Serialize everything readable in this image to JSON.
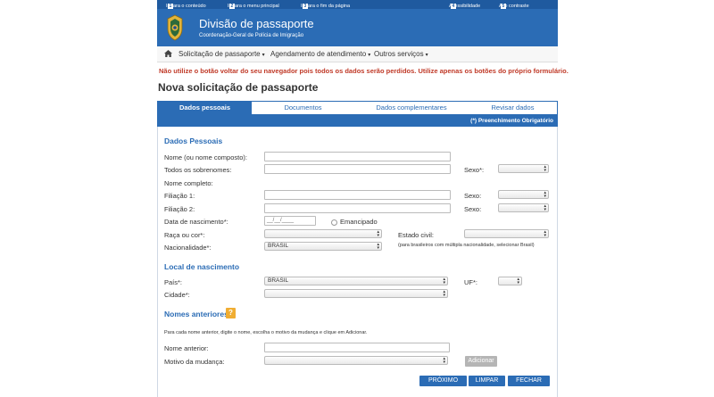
{
  "topbar": {
    "skip_content": "Ir para o conteúdo",
    "skip_content_key": "1",
    "skip_menu": "Ir para o menu principal",
    "skip_menu_key": "2",
    "skip_end": "Ir para o fim da página",
    "skip_end_key": "3",
    "accessibility": "Acessibilidade",
    "accessibility_key": "4",
    "contrast": "Alto contraste",
    "contrast_key": "5"
  },
  "header": {
    "title": "Divisão de passaporte",
    "subtitle": "Coordenação-Geral de Polícia de Imigração"
  },
  "nav": {
    "home_icon": "home-icon",
    "items": [
      {
        "label": "Solicitação de passaporte"
      },
      {
        "label": "Agendamento de atendimento"
      },
      {
        "label": "Outros serviços"
      }
    ]
  },
  "warning": "Não utilize o botão voltar do seu navegador pois todos os dados serão perdidos. Utilize apenas os botões do próprio formulário.",
  "page_title": "Nova solicitação de passaporte",
  "tabs": [
    {
      "label": "Dados pessoais",
      "active": true
    },
    {
      "label": "Documentos",
      "active": false
    },
    {
      "label": "Dados complementares",
      "active": false
    },
    {
      "label": "Revisar dados",
      "active": false
    }
  ],
  "required_note": "(*) Preenchimento Obrigatório",
  "personal": {
    "section_title": "Dados Pessoais",
    "name_label": "Nome (ou nome composto):",
    "surnames_label": "Todos os sobrenomes:",
    "sex_label": "Sexo*:",
    "full_name_label": "Nome completo:",
    "parent1_label": "Filiação 1:",
    "parent1_sex_label": "Sexo:",
    "parent2_label": "Filiação 2:",
    "parent2_sex_label": "Sexo:",
    "birth_label": "Data de nascimento*:",
    "birth_placeholder": "__/__/____",
    "emancipated_label": "Emancipado",
    "race_label": "Raça ou cor*:",
    "civil_label": "Estado civil:",
    "nationality_label": "Nacionalidade*:",
    "nationality_value": "BRASIL",
    "nationality_hint": "(para brasileiros com múltipla nacionalidade, selecionar Brasil)"
  },
  "birthplace": {
    "section_title": "Local de nascimento",
    "country_label": "País*:",
    "country_value": "BRASIL",
    "uf_label": "UF*:",
    "city_label": "Cidade*:"
  },
  "previous": {
    "section_title": "Nomes anteriores",
    "help_label": "?",
    "instructions": "Para cada nome anterior, digite o nome, escolha o motivo da mudança e clique em Adicionar.",
    "name_label": "Nome anterior:",
    "reason_label": "Motivo da mudança:",
    "add_button": "Adicionar"
  },
  "actions": {
    "next": "PRÓXIMO",
    "clear": "LIMPAR",
    "close": "FECHAR"
  },
  "colors": {
    "primary": "#2b6cb5",
    "warning": "#c03a28",
    "help": "#f0ad32"
  }
}
